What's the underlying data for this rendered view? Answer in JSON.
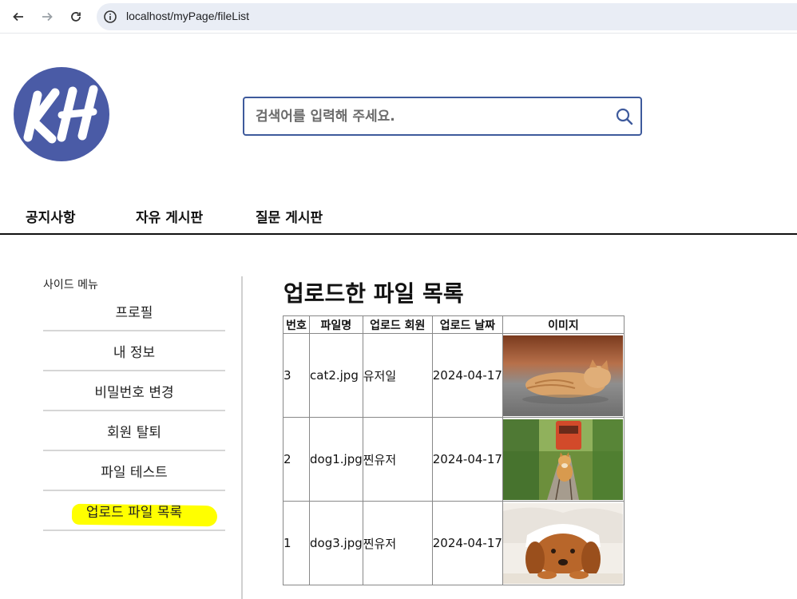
{
  "browser": {
    "url": "localhost/myPage/fileList"
  },
  "header": {
    "logo_text": "KH",
    "search_placeholder": "검색어를 입력해 주세요."
  },
  "top_nav": {
    "items": [
      "공지사항",
      "자유 게시판",
      "질문 게시판"
    ]
  },
  "sidebar": {
    "title": "사이드 메뉴",
    "items": [
      "프로필",
      "내 정보",
      "비밀번호 변경",
      "회원 탈퇴",
      "파일 테스트",
      "업로드 파일 목록"
    ],
    "highlight_color": "#ffff00"
  },
  "main": {
    "title": "업로드한 파일 목록",
    "table": {
      "headers": [
        "번호",
        "파일명",
        "업로드 회원",
        "업로드 날짜",
        "이미지"
      ],
      "rows": [
        {
          "no": "3",
          "file": "cat2.jpg",
          "member": "유저일",
          "date": "2024-04-17",
          "image": "sleeping-kitten"
        },
        {
          "no": "2",
          "file": "dog1.jpg",
          "member": "찐유저",
          "date": "2024-04-17",
          "image": "shiba-dog-on-track"
        },
        {
          "no": "1",
          "file": "dog3.jpg",
          "member": "찐유저",
          "date": "2024-04-17",
          "image": "spaniel-under-blanket"
        }
      ]
    }
  },
  "colors": {
    "logo_blue": "#4a5ba6",
    "search_border": "#3e5a9c",
    "address_bar_bg": "#e9edf5"
  }
}
